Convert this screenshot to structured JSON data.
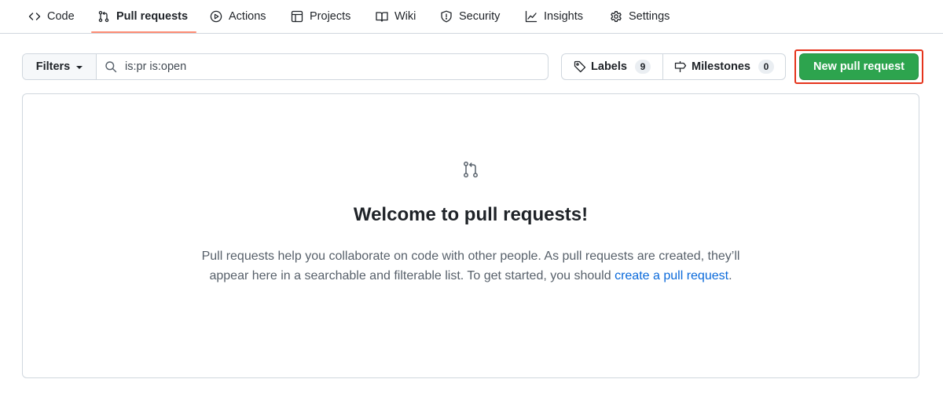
{
  "nav": {
    "items": [
      {
        "label": "Code",
        "icon": "code-icon"
      },
      {
        "label": "Pull requests",
        "icon": "git-pull-request-icon",
        "active": true
      },
      {
        "label": "Actions",
        "icon": "play-icon"
      },
      {
        "label": "Projects",
        "icon": "table-icon"
      },
      {
        "label": "Wiki",
        "icon": "book-icon"
      },
      {
        "label": "Security",
        "icon": "shield-icon"
      },
      {
        "label": "Insights",
        "icon": "graph-icon"
      },
      {
        "label": "Settings",
        "icon": "gear-icon"
      }
    ],
    "active_underline_color": "#fd8c73"
  },
  "toolbar": {
    "filters_label": "Filters",
    "search_value": "is:pr is:open",
    "labels_label": "Labels",
    "labels_count": "9",
    "milestones_label": "Milestones",
    "milestones_count": "0",
    "new_pr_label": "New pull request",
    "new_pr_color": "#2da44e"
  },
  "blankslate": {
    "title": "Welcome to pull requests!",
    "description": "Pull requests help you collaborate on code with other people. As pull requests are created, they’ll appear here in a searchable and filterable list. To get started, you should ",
    "link_text": "create a pull request",
    "trailing": "."
  },
  "colors": {
    "link": "#0969da",
    "highlight": "#e5341c",
    "border": "#d0d7de"
  }
}
